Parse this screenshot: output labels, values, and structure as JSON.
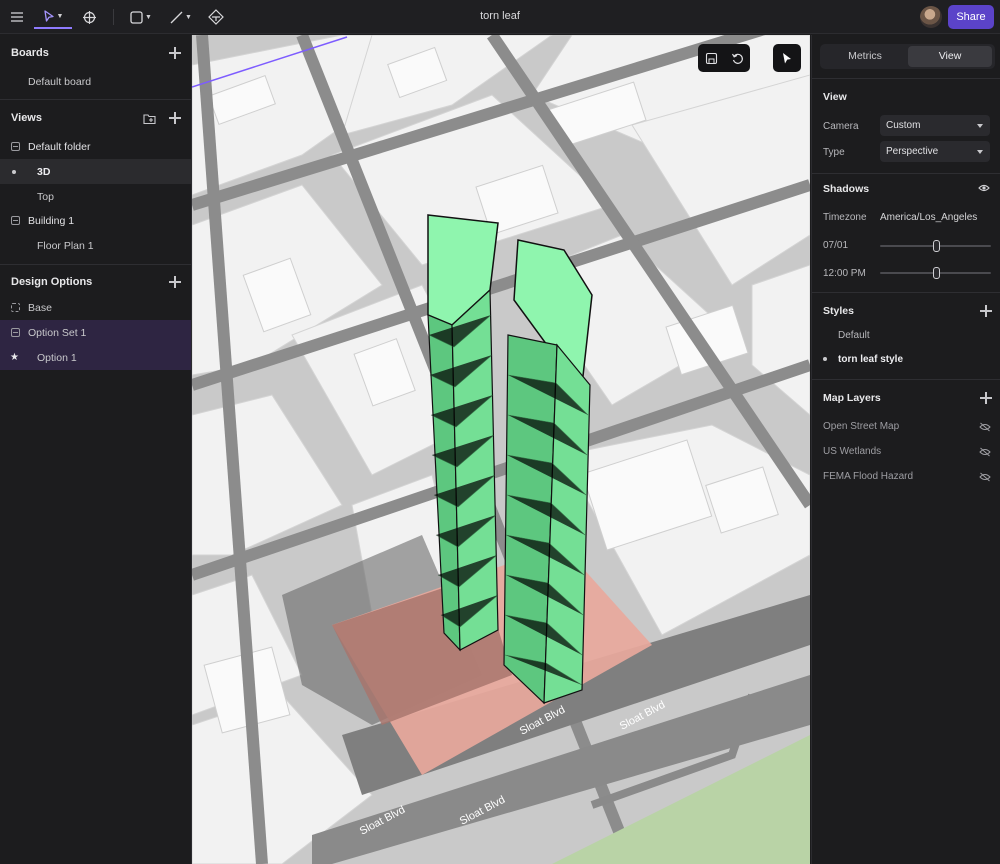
{
  "topbar": {
    "title": "torn leaf",
    "share_label": "Share",
    "tools": [
      "menu-icon",
      "pointer-icon",
      "move-icon",
      "rectangle-icon",
      "line-icon",
      "shape-tool-icon"
    ]
  },
  "left": {
    "boards": {
      "title": "Boards",
      "items": [
        "Default board"
      ]
    },
    "views": {
      "title": "Views",
      "items": [
        {
          "label": "Default folder",
          "kind": "folder"
        },
        {
          "label": "3D",
          "kind": "view",
          "selected": true
        },
        {
          "label": "Top",
          "kind": "view"
        },
        {
          "label": "Building 1",
          "kind": "folder"
        },
        {
          "label": "Floor Plan 1",
          "kind": "view"
        }
      ]
    },
    "design_options": {
      "title": "Design Options",
      "items": [
        {
          "label": "Base",
          "kind": "base"
        },
        {
          "label": "Option Set 1",
          "kind": "set"
        },
        {
          "label": "Option 1",
          "kind": "option",
          "active": true
        }
      ]
    }
  },
  "viewport": {
    "street_labels": [
      "Sloat Blvd",
      "Sloat Blvd",
      "Sloat Blvd",
      "Sloat Blvd"
    ],
    "tools": [
      "save-view-icon",
      "reset-view-icon",
      "select-cursor-icon"
    ]
  },
  "right": {
    "tabs": [
      "Metrics",
      "View"
    ],
    "active_tab": "View",
    "view": {
      "title": "View",
      "camera_label": "Camera",
      "camera_value": "Custom",
      "type_label": "Type",
      "type_value": "Perspective"
    },
    "shadows": {
      "title": "Shadows",
      "timezone_label": "Timezone",
      "timezone_value": "America/Los_Angeles",
      "date_label": "07/01",
      "date_level": 0.5,
      "time_label": "12:00 PM",
      "time_level": 0.5
    },
    "styles": {
      "title": "Styles",
      "items": [
        "Default",
        "torn leaf style"
      ],
      "active": "torn leaf style"
    },
    "map_layers": {
      "title": "Map Layers",
      "items": [
        "Open Street Map",
        "US Wetlands",
        "FEMA Flood Hazard"
      ]
    }
  },
  "colors": {
    "accent": "#5b43c9",
    "tower": "#86f0a4",
    "site": "#e8a89c",
    "park": "#b9d3a6"
  }
}
